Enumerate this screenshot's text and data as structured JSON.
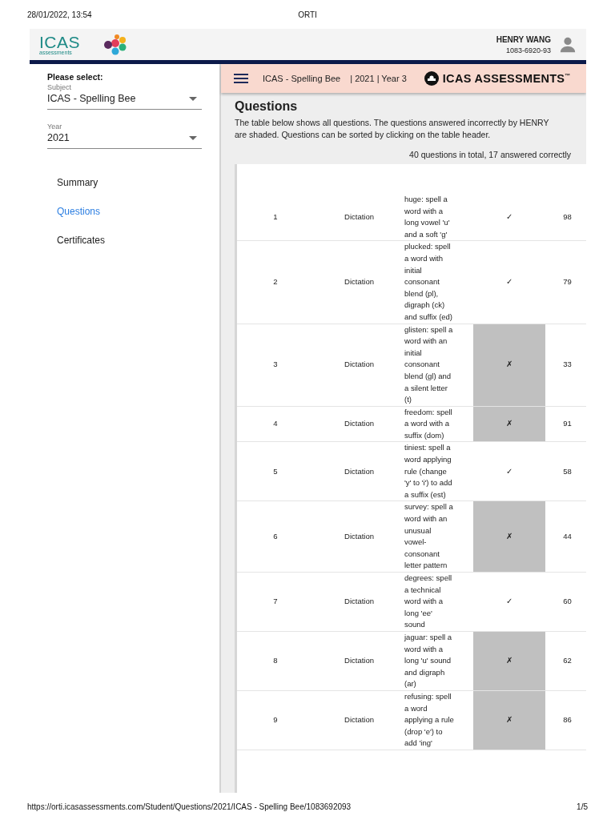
{
  "print_header": {
    "date": "28/01/2022, 13:54",
    "title": "ORTI"
  },
  "topbar": {
    "logo_main": "ICAS",
    "logo_sub": "assessments",
    "user_name": "HENRY WANG",
    "user_id": "1083-6920-93"
  },
  "sidebar": {
    "heading": "Please select:",
    "fields": [
      {
        "label": "Subject",
        "value": "ICAS - Spelling Bee"
      },
      {
        "label": "Year",
        "value": "2021"
      }
    ],
    "items": [
      {
        "label": "Summary",
        "selected": false
      },
      {
        "label": "Questions",
        "selected": true
      },
      {
        "label": "Certificates",
        "selected": false
      }
    ]
  },
  "subheader": {
    "subject": "ICAS - Spelling Bee",
    "year_level": "| 2021 | Year 3",
    "brand": "ICAS ASSESSMENTS",
    "brand_mark": "™"
  },
  "content": {
    "title": "Questions",
    "intro": "The table below shows all questions. The questions answered incorrectly by HENRY are shaded. Questions can be sorted by clicking on the table header.",
    "summary": "40 questions in total, 17 answered correctly"
  },
  "table": {
    "rows": [
      {
        "number": "1",
        "type": "Dictation",
        "description": "huge: spell a word with a long vowel 'u' and a soft 'g'",
        "mark": "✓",
        "correct": true,
        "score": "98"
      },
      {
        "number": "2",
        "type": "Dictation",
        "description": "plucked: spell a word with initial consonant blend (pl), digraph (ck) and suffix (ed)",
        "mark": "✓",
        "correct": true,
        "score": "79"
      },
      {
        "number": "3",
        "type": "Dictation",
        "description": "glisten: spell a word with an initial consonant blend (gl) and a silent letter (t)",
        "mark": "✗",
        "correct": false,
        "score": "33"
      },
      {
        "number": "4",
        "type": "Dictation",
        "description": "freedom: spell a word with a suffix (dom)",
        "mark": "✗",
        "correct": false,
        "score": "91"
      },
      {
        "number": "5",
        "type": "Dictation",
        "description": "tiniest: spell a word applying rule (change 'y' to 'i') to add a suffix (est)",
        "mark": "✓",
        "correct": true,
        "score": "58"
      },
      {
        "number": "6",
        "type": "Dictation",
        "description": "survey: spell a word with an unusual vowel-consonant letter pattern",
        "mark": "✗",
        "correct": false,
        "score": "44"
      },
      {
        "number": "7",
        "type": "Dictation",
        "description": "degrees: spell a technical word with a long 'ee' sound",
        "mark": "✓",
        "correct": true,
        "score": "60"
      },
      {
        "number": "8",
        "type": "Dictation",
        "description": "jaguar: spell a word with a long 'u' sound and digraph (ar)",
        "mark": "✗",
        "correct": false,
        "score": "62"
      },
      {
        "number": "9",
        "type": "Dictation",
        "description": "refusing: spell a word applying a rule (drop 'e') to add 'ing'",
        "mark": "✗",
        "correct": false,
        "score": "86"
      }
    ]
  },
  "print_footer": {
    "url": "https://orti.icasassessments.com/Student/Questions/2021/ICAS - Spelling Bee/1083692093",
    "page": "1/5"
  }
}
